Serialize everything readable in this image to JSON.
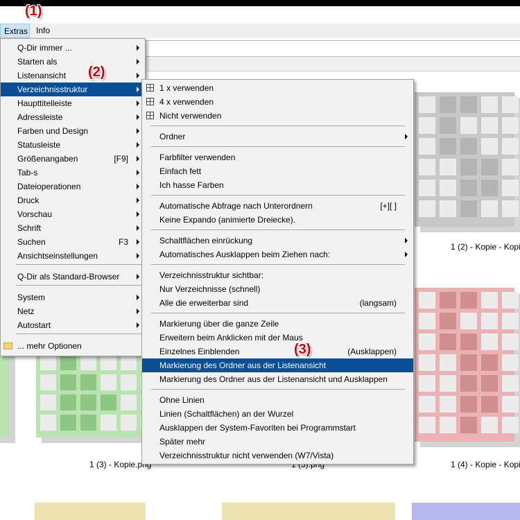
{
  "menubar": {
    "extras": "Extras",
    "info": "Info"
  },
  "steps": {
    "s1": "(1)",
    "s2": "(2)",
    "s3": "(3)"
  },
  "captions": {
    "c1": "1 (2) - Kopie - Kopi",
    "c2": "1 (3) - Kopie.png",
    "c3": "1 (5).png",
    "c4": "1 (4) - Kopie - Kopi"
  },
  "extras_menu": {
    "items": [
      {
        "label": "Q-Dir immer ...",
        "submenu": true
      },
      {
        "label": "Starten als",
        "submenu": true
      },
      {
        "label": "Listenansicht",
        "submenu": true
      },
      {
        "label": "Verzeichnisstruktur",
        "submenu": true
      },
      {
        "label": "Haupttitelleiste",
        "submenu": true
      },
      {
        "label": "Adressleiste",
        "submenu": true
      },
      {
        "label": "Farben und Design",
        "submenu": true
      },
      {
        "label": "Statusleiste",
        "submenu": true
      },
      {
        "label": "Größenangaben",
        "shortcut": "[F9]",
        "submenu": true
      },
      {
        "label": "Tab-s",
        "submenu": true
      },
      {
        "label": "Dateioperationen",
        "submenu": true
      },
      {
        "label": "Druck",
        "submenu": true
      },
      {
        "label": "Vorschau",
        "submenu": true
      },
      {
        "label": "Schrift",
        "submenu": true
      },
      {
        "label": "Suchen",
        "shortcut": "F3",
        "submenu": true
      },
      {
        "label": "Ansichtseinstellungen",
        "submenu": true
      },
      {
        "label": "Q-Dir als Standard-Browser",
        "submenu": true
      },
      {
        "label": "System",
        "submenu": true
      },
      {
        "label": "Netz",
        "submenu": true
      },
      {
        "label": "Autostart",
        "submenu": true
      },
      {
        "label": "... mehr Optionen",
        "submenu": false
      }
    ]
  },
  "sub_menu": {
    "items": [
      {
        "label": "1 x verwenden"
      },
      {
        "label": "4 x verwenden"
      },
      {
        "label": "Nicht verwenden"
      },
      {
        "label": "Ordner"
      },
      {
        "label": "Farbfilter verwenden"
      },
      {
        "label": "Einfach fett"
      },
      {
        "label": "Ich hasse Farben"
      },
      {
        "label": "Automatische Abfrage nach Unterordnern",
        "shortcut": "[+][ ]"
      },
      {
        "label": "Keine Expando (animierte Dreiecke)."
      },
      {
        "label": "Schaltflächen einrückung"
      },
      {
        "label": "Automatisches Ausklappen beim Ziehen nach:"
      },
      {
        "label": "Verzeichnisstruktur sichtbar:"
      },
      {
        "label": "Nur Verzeichnisse (schnell)"
      },
      {
        "label": "Alle die erweiterbar sind",
        "shortcut": "(langsam)"
      },
      {
        "label": "Markierung über die ganze Zeile"
      },
      {
        "label": "Erweitern beim Anklicken mit der Maus"
      },
      {
        "label": "Einzelnes Einblenden",
        "shortcut": "(Ausklappen)"
      },
      {
        "label": "Markierung des Ordner aus der Listenansicht"
      },
      {
        "label": "Markierung des Ordner aus der Listenansicht und Ausklappen"
      },
      {
        "label": "Ohne Linien"
      },
      {
        "label": "Linien (Schaltflächen) an der Wurzel"
      },
      {
        "label": "Ausklappen der System-Favoriten bei Programmstart"
      },
      {
        "label": "Später mehr"
      },
      {
        "label": "Verzeichnisstruktur nicht verwenden (W7/Vista)"
      }
    ]
  },
  "colors": {
    "highlight": "#0a4e96",
    "gray_thumb": "#c8c8c8",
    "red_thumb": "#e9b3b3",
    "green_thumb": "#b9e3b0",
    "yellow_thumb": "#ece3b0",
    "blue_thumb": "#b7b7ef"
  }
}
